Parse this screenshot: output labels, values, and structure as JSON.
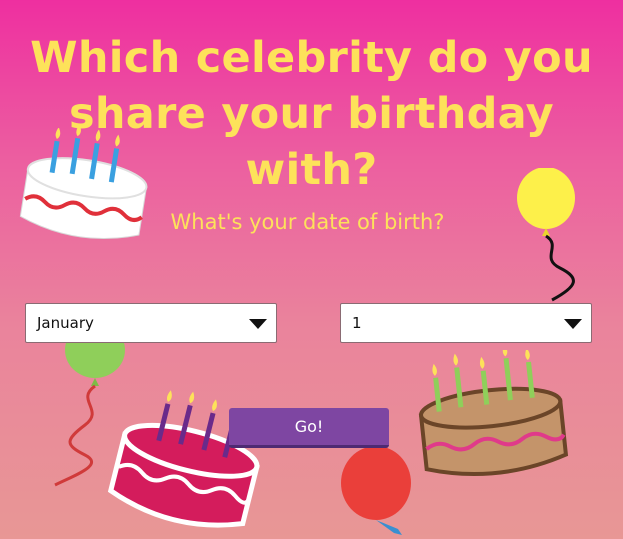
{
  "header": {
    "title_line1": "Which celebrity do you",
    "title_line2": "share your birthday with?"
  },
  "form": {
    "question": "What's your date of birth?",
    "month": {
      "value": "January"
    },
    "day": {
      "value": "1"
    },
    "submit_label": "Go!"
  },
  "colors": {
    "title": "#fde25a",
    "button": "#7e46a2",
    "background_top": "#ee2fa0",
    "background_bottom": "#e89795"
  },
  "decorations": [
    "birthday-cake-icon",
    "balloon-icon"
  ]
}
